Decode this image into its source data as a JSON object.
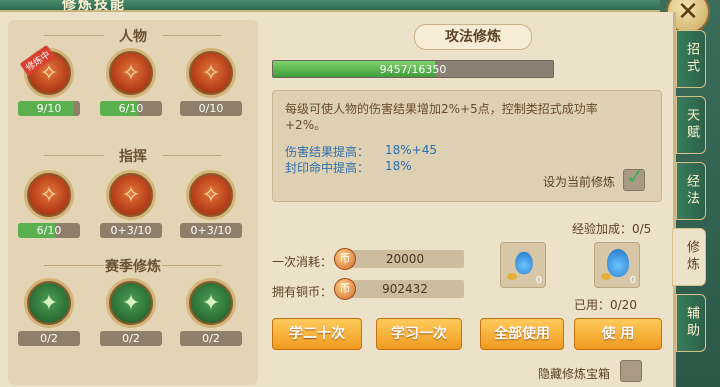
{
  "window": {
    "title": "修炼技能"
  },
  "left": {
    "sections": [
      {
        "title": "人物",
        "skills": [
          {
            "level": "9/10",
            "progress": 0.9,
            "badge": "修炼中",
            "theme": "red",
            "icon": "sword-emblem-icon"
          },
          {
            "level": "6/10",
            "progress": 0.6,
            "badge": "",
            "theme": "red",
            "icon": "shield-emblem-icon"
          },
          {
            "level": "0/10",
            "progress": 0.0,
            "badge": "",
            "theme": "red",
            "icon": "tiger-emblem-icon"
          }
        ]
      },
      {
        "title": "指挥",
        "skills": [
          {
            "level": "6/10",
            "progress": 0.6,
            "badge": "",
            "theme": "red",
            "icon": "beast-emblem-icon"
          },
          {
            "level": "0+3/10",
            "progress": 0.0,
            "badge": "",
            "theme": "red",
            "icon": "beast-shield-icon"
          },
          {
            "level": "0+3/10",
            "progress": 0.0,
            "badge": "",
            "theme": "red",
            "icon": "beast-guard-icon"
          }
        ]
      },
      {
        "title": "赛季修炼",
        "skills": [
          {
            "level": "0/2",
            "progress": 0.0,
            "badge": "",
            "theme": "green",
            "icon": "sword-green-icon"
          },
          {
            "level": "0/2",
            "progress": 0.0,
            "badge": "",
            "theme": "green",
            "icon": "shield-green-icon"
          },
          {
            "level": "0/2",
            "progress": 0.0,
            "badge": "",
            "theme": "green",
            "icon": "hex-green-icon"
          }
        ]
      }
    ]
  },
  "detail": {
    "skill_name": "攻法修炼",
    "xp_text": "9457/16350",
    "xp_progress": 0.578,
    "description": "每级可使人物的伤害结果增加2%+5点，控制类招式成功率+2%。",
    "stats": [
      {
        "label": "伤害结果提高：",
        "value": "18%+45"
      },
      {
        "label": "封印命中提高：",
        "value": "18%"
      }
    ],
    "set_current_label": "设为当前修炼",
    "set_current_checked": true
  },
  "costs": {
    "once_label": "一次消耗：",
    "once_value": "20000",
    "owned_label": "拥有铜币：",
    "owned_value": "902432"
  },
  "bonus": {
    "label": "经验加成：0/5",
    "items": [
      {
        "icon": "small-potion-icon",
        "count": "0"
      },
      {
        "icon": "large-potion-icon",
        "count": "0"
      }
    ],
    "used_label": "已用：0/20"
  },
  "buttons": {
    "learn20": "学二十次",
    "learn1": "学习一次",
    "use_all": "全部使用",
    "use": "使 用"
  },
  "hide_box": {
    "label": "隐藏修炼宝箱",
    "checked": false
  },
  "side_tabs": [
    {
      "label": "招式",
      "active": false
    },
    {
      "label": "天赋",
      "active": false
    },
    {
      "label": "经法",
      "active": false
    },
    {
      "label": "修炼",
      "active": true
    },
    {
      "label": "辅助",
      "active": false
    }
  ]
}
